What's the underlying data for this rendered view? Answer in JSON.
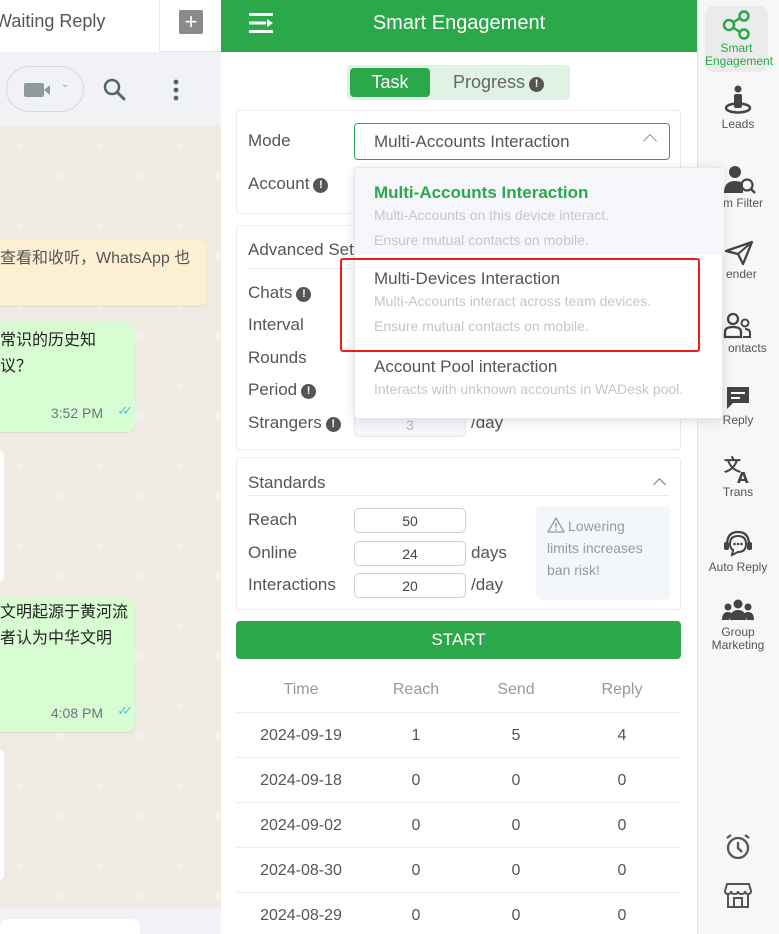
{
  "chat": {
    "tab_label": "Waiting Reply",
    "add_tab_icon": "plus-icon",
    "header_icons": [
      "video-call-icon",
      "search-icon",
      "more-vertical-icon"
    ],
    "messages": [
      {
        "type": "system",
        "text": "查看和收听，WhatsApp 也"
      },
      {
        "type": "outgoing",
        "lines": [
          "常识的历史知",
          "议？"
        ],
        "time": "3:52 PM",
        "status": "read"
      },
      {
        "type": "outgoing",
        "lines": [
          "文明起源于黄河流",
          "者认为中华文明"
        ],
        "time": "4:08 PM",
        "status": "read"
      }
    ]
  },
  "panel": {
    "title": "Smart Engagement",
    "menu_icon": "menu-collapse-icon",
    "tabs": [
      {
        "label": "Task",
        "active": true
      },
      {
        "label": "Progress",
        "active": false,
        "badge": "!"
      }
    ],
    "mode": {
      "label": "Mode",
      "selected": "Multi-Accounts Interaction",
      "options": [
        {
          "title": "Multi-Accounts Interaction",
          "desc": [
            "Multi-Accounts on this device interact.",
            "Ensure mutual contacts on mobile."
          ],
          "active": true
        },
        {
          "title": "Multi-Devices Interaction",
          "desc": [
            "Multi-Accounts interact across team devices.",
            "Ensure mutual contacts on mobile."
          ],
          "highlighted": true
        },
        {
          "title": "Account Pool interaction",
          "desc": [
            "Interacts with unknown accounts in WADesk pool."
          ]
        }
      ]
    },
    "account": {
      "label": "Account",
      "badge": "!"
    },
    "advanced": {
      "title": "Advanced Settings",
      "title_visible": "Advanced Set",
      "fields": [
        {
          "label": "Chats",
          "badge": "!"
        },
        {
          "label": "Interval"
        },
        {
          "label": "Rounds"
        },
        {
          "label": "Period",
          "badge": "!"
        },
        {
          "label": "Strangers",
          "badge": "!",
          "value": "3",
          "unit": "/day"
        }
      ]
    },
    "standards": {
      "title": "Standards",
      "fields": [
        {
          "label": "Reach",
          "value": "50",
          "unit": ""
        },
        {
          "label": "Online",
          "value": "24",
          "unit": "days"
        },
        {
          "label": "Interactions",
          "value": "20",
          "unit": "/day"
        }
      ],
      "warning_line1": "Lowering",
      "warning_line2": "limits increases",
      "warning_line3": "ban risk!"
    },
    "start_label": "START",
    "table": {
      "columns": [
        "Time",
        "Reach",
        "Send",
        "Reply"
      ],
      "rows": [
        [
          "2024-09-19",
          "1",
          "5",
          "4"
        ],
        [
          "2024-09-18",
          "0",
          "0",
          "0"
        ],
        [
          "2024-09-02",
          "0",
          "0",
          "0"
        ],
        [
          "2024-08-30",
          "0",
          "0",
          "0"
        ],
        [
          "2024-08-29",
          "0",
          "0",
          "0"
        ]
      ]
    }
  },
  "rail": {
    "items": [
      {
        "label_line1": "Smart",
        "label_line2": "Engagement",
        "icon": "share-nodes-icon",
        "active": true
      },
      {
        "label": "Leads",
        "icon": "person-pin-icon"
      },
      {
        "label": "m Filter",
        "icon": "user-search-icon"
      },
      {
        "label": "ender",
        "icon": "send-icon"
      },
      {
        "label": "ontacts",
        "icon": "contacts-icon"
      },
      {
        "label": "Reply",
        "icon": "message-icon"
      },
      {
        "label": "Trans",
        "icon": "translate-icon"
      },
      {
        "label": "Auto Reply",
        "icon": "headset-chat-icon"
      },
      {
        "label_line1": "Group",
        "label_line2": "Marketing",
        "icon": "group-icon"
      },
      {
        "icon": "alarm-clock-icon"
      },
      {
        "icon": "store-icon"
      }
    ]
  },
  "colors": {
    "brand": "#2aa84a",
    "highlight": "#f01c1c",
    "outgoing_bubble": "#d9fdd3",
    "system_bubble": "#fdf0d2"
  }
}
